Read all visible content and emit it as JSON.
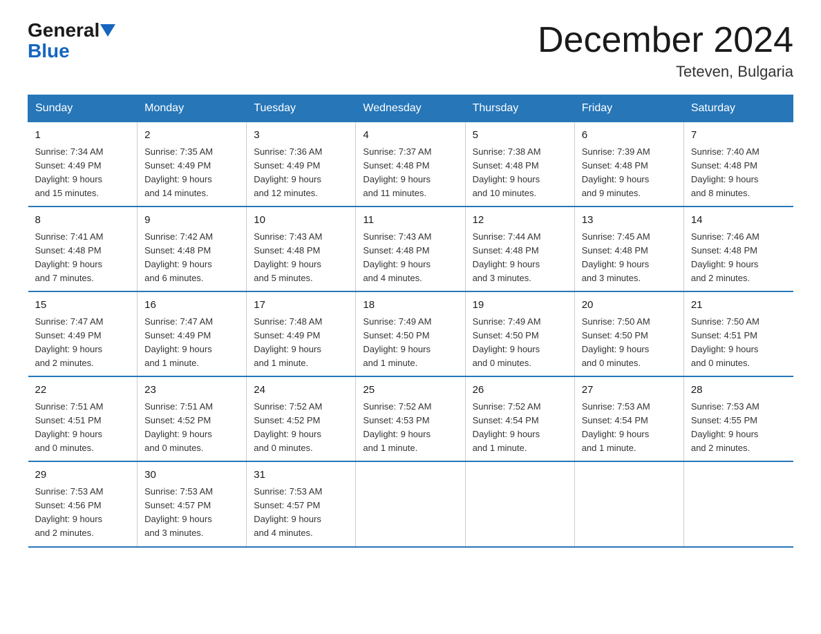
{
  "header": {
    "logo_general": "General",
    "logo_blue": "Blue",
    "month_title": "December 2024",
    "location": "Teteven, Bulgaria"
  },
  "weekdays": [
    "Sunday",
    "Monday",
    "Tuesday",
    "Wednesday",
    "Thursday",
    "Friday",
    "Saturday"
  ],
  "weeks": [
    [
      {
        "day": "1",
        "sunrise": "7:34 AM",
        "sunset": "4:49 PM",
        "daylight": "9 hours and 15 minutes."
      },
      {
        "day": "2",
        "sunrise": "7:35 AM",
        "sunset": "4:49 PM",
        "daylight": "9 hours and 14 minutes."
      },
      {
        "day": "3",
        "sunrise": "7:36 AM",
        "sunset": "4:49 PM",
        "daylight": "9 hours and 12 minutes."
      },
      {
        "day": "4",
        "sunrise": "7:37 AM",
        "sunset": "4:48 PM",
        "daylight": "9 hours and 11 minutes."
      },
      {
        "day": "5",
        "sunrise": "7:38 AM",
        "sunset": "4:48 PM",
        "daylight": "9 hours and 10 minutes."
      },
      {
        "day": "6",
        "sunrise": "7:39 AM",
        "sunset": "4:48 PM",
        "daylight": "9 hours and 9 minutes."
      },
      {
        "day": "7",
        "sunrise": "7:40 AM",
        "sunset": "4:48 PM",
        "daylight": "9 hours and 8 minutes."
      }
    ],
    [
      {
        "day": "8",
        "sunrise": "7:41 AM",
        "sunset": "4:48 PM",
        "daylight": "9 hours and 7 minutes."
      },
      {
        "day": "9",
        "sunrise": "7:42 AM",
        "sunset": "4:48 PM",
        "daylight": "9 hours and 6 minutes."
      },
      {
        "day": "10",
        "sunrise": "7:43 AM",
        "sunset": "4:48 PM",
        "daylight": "9 hours and 5 minutes."
      },
      {
        "day": "11",
        "sunrise": "7:43 AM",
        "sunset": "4:48 PM",
        "daylight": "9 hours and 4 minutes."
      },
      {
        "day": "12",
        "sunrise": "7:44 AM",
        "sunset": "4:48 PM",
        "daylight": "9 hours and 3 minutes."
      },
      {
        "day": "13",
        "sunrise": "7:45 AM",
        "sunset": "4:48 PM",
        "daylight": "9 hours and 3 minutes."
      },
      {
        "day": "14",
        "sunrise": "7:46 AM",
        "sunset": "4:48 PM",
        "daylight": "9 hours and 2 minutes."
      }
    ],
    [
      {
        "day": "15",
        "sunrise": "7:47 AM",
        "sunset": "4:49 PM",
        "daylight": "9 hours and 2 minutes."
      },
      {
        "day": "16",
        "sunrise": "7:47 AM",
        "sunset": "4:49 PM",
        "daylight": "9 hours and 1 minute."
      },
      {
        "day": "17",
        "sunrise": "7:48 AM",
        "sunset": "4:49 PM",
        "daylight": "9 hours and 1 minute."
      },
      {
        "day": "18",
        "sunrise": "7:49 AM",
        "sunset": "4:50 PM",
        "daylight": "9 hours and 1 minute."
      },
      {
        "day": "19",
        "sunrise": "7:49 AM",
        "sunset": "4:50 PM",
        "daylight": "9 hours and 0 minutes."
      },
      {
        "day": "20",
        "sunrise": "7:50 AM",
        "sunset": "4:50 PM",
        "daylight": "9 hours and 0 minutes."
      },
      {
        "day": "21",
        "sunrise": "7:50 AM",
        "sunset": "4:51 PM",
        "daylight": "9 hours and 0 minutes."
      }
    ],
    [
      {
        "day": "22",
        "sunrise": "7:51 AM",
        "sunset": "4:51 PM",
        "daylight": "9 hours and 0 minutes."
      },
      {
        "day": "23",
        "sunrise": "7:51 AM",
        "sunset": "4:52 PM",
        "daylight": "9 hours and 0 minutes."
      },
      {
        "day": "24",
        "sunrise": "7:52 AM",
        "sunset": "4:52 PM",
        "daylight": "9 hours and 0 minutes."
      },
      {
        "day": "25",
        "sunrise": "7:52 AM",
        "sunset": "4:53 PM",
        "daylight": "9 hours and 1 minute."
      },
      {
        "day": "26",
        "sunrise": "7:52 AM",
        "sunset": "4:54 PM",
        "daylight": "9 hours and 1 minute."
      },
      {
        "day": "27",
        "sunrise": "7:53 AM",
        "sunset": "4:54 PM",
        "daylight": "9 hours and 1 minute."
      },
      {
        "day": "28",
        "sunrise": "7:53 AM",
        "sunset": "4:55 PM",
        "daylight": "9 hours and 2 minutes."
      }
    ],
    [
      {
        "day": "29",
        "sunrise": "7:53 AM",
        "sunset": "4:56 PM",
        "daylight": "9 hours and 2 minutes."
      },
      {
        "day": "30",
        "sunrise": "7:53 AM",
        "sunset": "4:57 PM",
        "daylight": "9 hours and 3 minutes."
      },
      {
        "day": "31",
        "sunrise": "7:53 AM",
        "sunset": "4:57 PM",
        "daylight": "9 hours and 4 minutes."
      },
      null,
      null,
      null,
      null
    ]
  ],
  "labels": {
    "sunrise": "Sunrise:",
    "sunset": "Sunset:",
    "daylight": "Daylight:"
  }
}
